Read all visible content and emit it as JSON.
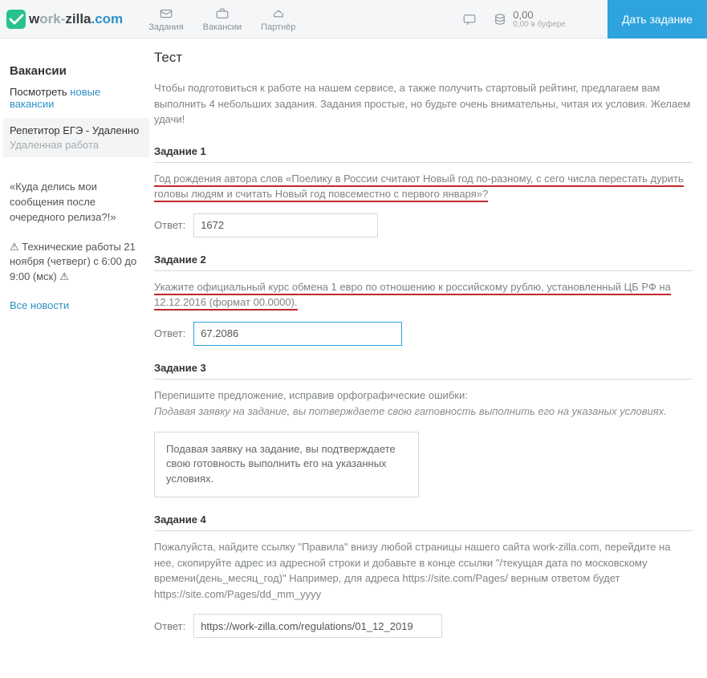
{
  "header": {
    "logo_prefix": "w",
    "logo_mid": "ork",
    "logo_dash": "-",
    "logo_bold": "zilla",
    "logo_suffix": ".com",
    "nav": [
      {
        "label": "Задания"
      },
      {
        "label": "Вакансии"
      },
      {
        "label": "Партнёр"
      }
    ],
    "balance": "0,00",
    "buffer": "0,00 в буфере",
    "cta": "Дать задание"
  },
  "sidebar": {
    "vacancies_heading": "Вакансии",
    "view_label": "Посмотреть",
    "view_link": "новые вакансии",
    "active": {
      "title": "Репетитор ЕГЭ - Удаленно",
      "sub": "Удаленная работа"
    },
    "news": [
      "«Куда делись мои сообщения после очередного релиза?!»",
      "⚠ Технические работы 21 ноября (четверг) с 6:00 до 9:00 (мск) ⚠"
    ],
    "all_news": "Все новости"
  },
  "page": {
    "title": "Тест",
    "intro": "Чтобы подготовиться к работе на нашем сервисе, а также получить стартовый рейтинг, предлагаем вам выполнить 4 небольших задания. Задания простые, но будьте очень внимательны, читая их условия. Желаем удачи!",
    "answer_label": "Ответ:",
    "tasks": [
      {
        "title": "Задание 1",
        "question": "Год рождения автора слов «Поелику в России считают Новый год по-разному, с сего числа перестать дурить головы людям и считать Новый год повсеместно с первого января»?",
        "answer": "1672",
        "underlined": true
      },
      {
        "title": "Задание 2",
        "question": "Укажите официальный курс обмена 1 евро по отношению к российскому рублю, установленный ЦБ РФ на 12.12.2016 (формат 00.0000).",
        "answer": "67.2086",
        "underlined": true,
        "focused": true
      },
      {
        "title": "Задание 3",
        "question": "Перепишите предложение, исправив орфографические ошибки:",
        "sample": "Подавая заявку на задание, вы потверждаете свою гатовность выполнить его на указаных условиях.",
        "answer_long": "Подавая заявку на задание, вы подтверждаете свою готовность выполнить его на указанных условиях."
      },
      {
        "title": "Задание 4",
        "question": "Пожалуйста, найдите ссылку \"Правила\" внизу любой страницы нашего сайта work-zilla.com, перейдите на нее, скопируйте адрес из адресной строки и добавьте в конце ссылки \"/текущая дата по московскому времени(день_месяц_год)\" Например, для адреса https://site.com/Pages/ верным ответом будет https://site.com/Pages/dd_mm_yyyy",
        "answer": "https://work-zilla.com/regulations/01_12_2019"
      }
    ]
  }
}
